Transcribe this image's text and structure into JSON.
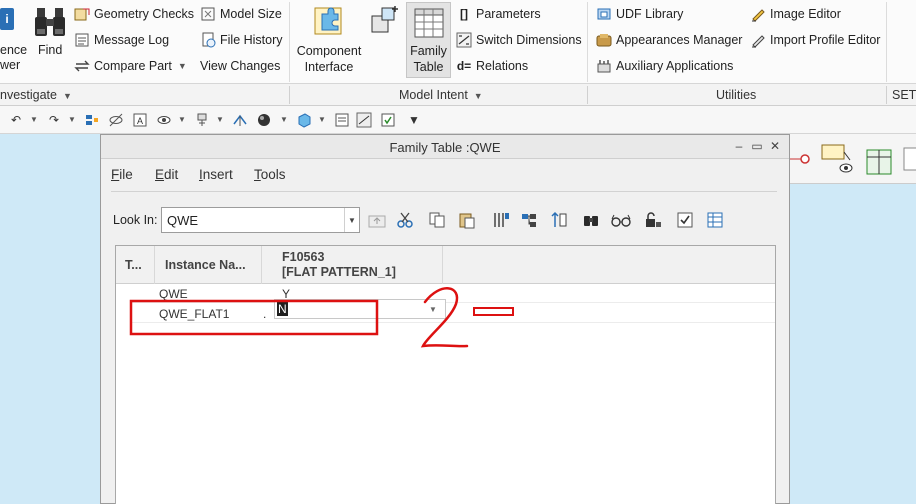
{
  "ribbon": {
    "left_cut_labels": [
      "ence",
      "wer"
    ],
    "find_label": "Find",
    "col1": [
      "Geometry Checks",
      "Message Log",
      "Compare Part"
    ],
    "col2": [
      "Model Size",
      "File History",
      "View Changes"
    ],
    "component_interface": [
      "Component",
      "Interface"
    ],
    "family_table": [
      "Family",
      "Table"
    ],
    "col3": [
      "Parameters",
      "Switch Dimensions",
      "Relations"
    ],
    "col4": [
      "UDF Library",
      "Appearances Manager",
      "Auxiliary Applications"
    ],
    "col5": [
      "Image Editor",
      "Import Profile Editor"
    ],
    "relations_prefix": "d=",
    "parameters_prefix": "[]"
  },
  "groups": {
    "investigate": "nvestigate",
    "model_intent": "Model Intent",
    "utilities": "Utilities",
    "set": "SET"
  },
  "icons": {
    "find": "binoculars-icon",
    "geometry_checks": "geometry-checks-icon",
    "model_size": "model-size-icon",
    "message_log": "message-log-icon",
    "file_history": "file-history-icon",
    "compare_part": "compare-part-icon",
    "component_interface": "puzzle-piece-icon",
    "family_table": "family-table-icon",
    "switch_dimensions": "switch-dimensions-icon",
    "udf_library": "udf-library-icon",
    "appearances_manager": "appearances-manager-icon",
    "auxiliary_applications": "auxiliary-applications-icon",
    "image_editor": "image-editor-icon",
    "import_profile_editor": "import-profile-editor-icon"
  },
  "dialog": {
    "title": "Family Table :QWE",
    "menus": [
      {
        "key": "F",
        "rest": "ile"
      },
      {
        "key": "E",
        "rest": "dit"
      },
      {
        "key": "I",
        "rest": "nsert"
      },
      {
        "key": "T",
        "rest": "ools"
      }
    ],
    "look_in_label": "Look In:",
    "look_in_value": "QWE",
    "table": {
      "headers": [
        "T...",
        "Instance Na...",
        "F10563",
        "[FLAT PATTERN_1]"
      ],
      "rows": [
        {
          "name": "QWE",
          "dot": "",
          "value": "Y"
        },
        {
          "name": "QWE_FLAT1",
          "dot": ".",
          "value": "N"
        }
      ]
    }
  },
  "colors": {
    "annotation_red": "#dd1111",
    "selection_black": "#1f1f1f",
    "desktop_blue": "#cfe9f7"
  },
  "annotation": {
    "scribble_text": "2"
  }
}
